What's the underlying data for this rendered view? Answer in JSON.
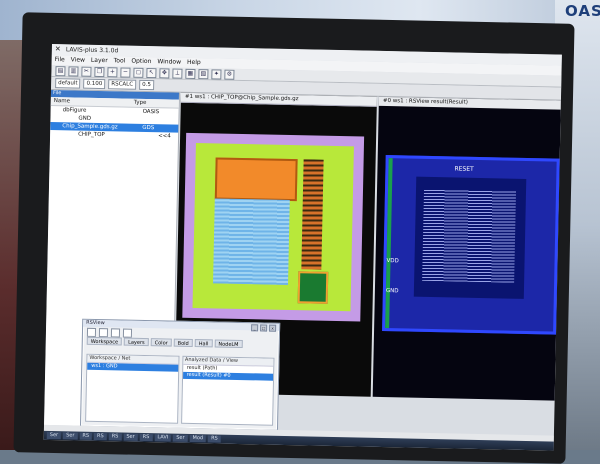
{
  "window": {
    "title": "LAVIS-plus 3.1.0d"
  },
  "menu": [
    "File",
    "View",
    "Layer",
    "Tool",
    "Option",
    "Window",
    "Help"
  ],
  "toolbar2": {
    "layer_select": "default",
    "zoom_value": "0.100",
    "rscalc_label": "RSCALC",
    "value_select": "0.5"
  },
  "tree": {
    "panel_label": "File",
    "col_name": "Name",
    "col_type": "Type",
    "rows": [
      {
        "name": "dbFigure",
        "type": "OASIS"
      },
      {
        "name": "GND",
        "type": ""
      },
      {
        "name": "Chip_Sample.gds.gz",
        "type": "GDS"
      },
      {
        "name": "CHIP_TOP",
        "type": "<<4"
      }
    ]
  },
  "view1": {
    "tab": "#1 ws1 : CHIP_TOP@Chip_Sample.gds.gz"
  },
  "view2": {
    "tab": "#0 ws1 : RSView result(Result)",
    "label_reset": "RESET",
    "label_vdd": "VDD",
    "label_gnd": "GND"
  },
  "dialog": {
    "title": "RSView",
    "tabs": [
      "Workspace",
      "Layers",
      "Color",
      "Bold",
      "Hall",
      "NodeLM"
    ],
    "left_header": "Workspace / Net",
    "left_item": "ws1 : GND",
    "right_header": "Analyzed Data / View",
    "right_items": [
      "result (Path)",
      "result (Result) #0"
    ]
  },
  "taskbar": [
    "Ser",
    "Ser",
    "RS",
    "RS",
    "RS",
    "Ser",
    "RS",
    "LAVI",
    "Ser",
    "Mod",
    "RS"
  ]
}
